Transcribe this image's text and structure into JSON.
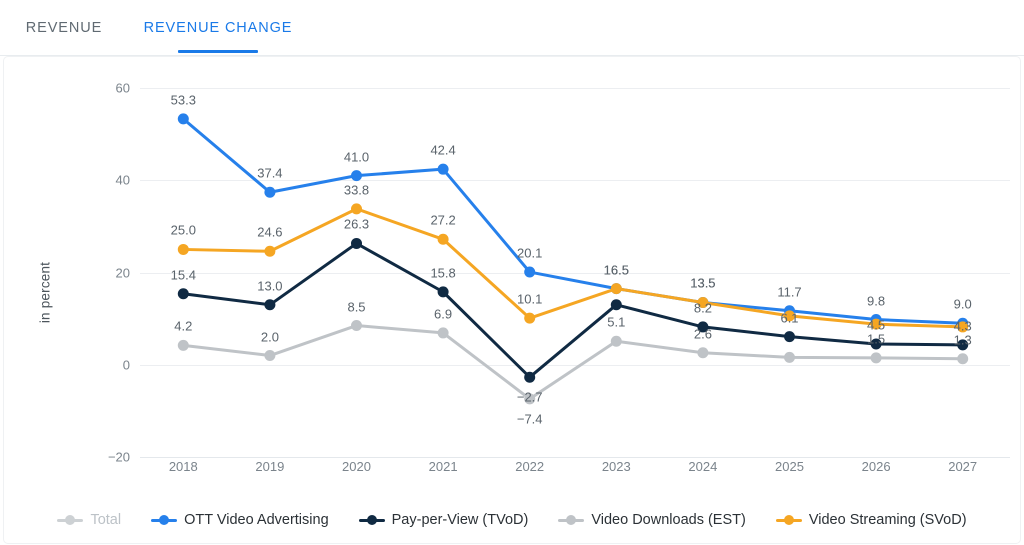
{
  "tabs": [
    {
      "label": "REVENUE",
      "active": false
    },
    {
      "label": "REVENUE CHANGE",
      "active": true
    }
  ],
  "colors": {
    "accent_blue": "#1a7ae8",
    "series_ott": "#2680eb",
    "series_tvod": "#102a43",
    "series_est": "#bfc3c7",
    "series_svod": "#f5a623",
    "series_total": "#cdd1d4",
    "tab_inactive": "#606a72",
    "gridline": "#eceef1",
    "label_text": "#5a636b"
  },
  "chart_data": {
    "type": "line",
    "title": "",
    "subtitle": "",
    "xlabel": "",
    "ylabel": "in percent",
    "categories": [
      "2018",
      "2019",
      "2020",
      "2021",
      "2022",
      "2023",
      "2024",
      "2025",
      "2026",
      "2027"
    ],
    "ylim": [
      -20,
      60
    ],
    "yticks": [
      60,
      40,
      20,
      0,
      -20
    ],
    "ytick_labels": [
      "60",
      "40",
      "20",
      "0",
      "−20"
    ],
    "grid": true,
    "legend_position": "bottom",
    "series": [
      {
        "name": "Total",
        "color": "#cdd1d4",
        "visible": false,
        "values": [
          null,
          null,
          null,
          null,
          null,
          null,
          null,
          null,
          null,
          null
        ],
        "labels": [
          "",
          "",
          "",
          "",
          "",
          "",
          "",
          "",
          "",
          ""
        ]
      },
      {
        "name": "OTT Video Advertising",
        "color": "#2680eb",
        "visible": true,
        "values": [
          53.3,
          37.4,
          41.0,
          42.4,
          20.1,
          16.5,
          13.5,
          11.7,
          9.8,
          9.0
        ],
        "labels": [
          "53.3",
          "37.4",
          "41.0",
          "42.4",
          "20.1",
          "16.5",
          "13.5",
          "11.7",
          "9.8",
          "9.0"
        ]
      },
      {
        "name": "Pay-per-View (TVoD)",
        "color": "#102a43",
        "visible": true,
        "values": [
          15.4,
          13.0,
          26.3,
          15.8,
          -2.7,
          13.0,
          8.2,
          6.1,
          4.5,
          4.3
        ],
        "labels": [
          "15.4",
          "13.0",
          "26.3",
          "15.8",
          "−2.7",
          "",
          "8.2",
          "6.1",
          "4.5",
          "4.3"
        ]
      },
      {
        "name": "Video Downloads (EST)",
        "color": "#bfc3c7",
        "visible": true,
        "values": [
          4.2,
          2.0,
          8.5,
          6.9,
          -7.4,
          5.1,
          2.6,
          1.6,
          1.5,
          1.3
        ],
        "labels": [
          "4.2",
          "2.0",
          "8.5",
          "6.9",
          "−7.4",
          "5.1",
          "2.6",
          "",
          "1.5",
          "1.3"
        ]
      },
      {
        "name": "Video Streaming (SVoD)",
        "color": "#f5a623",
        "visible": true,
        "values": [
          25.0,
          24.6,
          33.8,
          27.2,
          10.1,
          16.5,
          13.5,
          10.6,
          8.8,
          8.2
        ],
        "labels": [
          "25.0",
          "24.6",
          "33.8",
          "27.2",
          "10.1",
          "16.5",
          "13.5",
          "",
          "",
          ""
        ]
      }
    ]
  },
  "legend": [
    {
      "label": "Total",
      "color": "#cdd1d4",
      "disabled": true
    },
    {
      "label": "OTT Video Advertising",
      "color": "#2680eb",
      "disabled": false
    },
    {
      "label": "Pay-per-View (TVoD)",
      "color": "#102a43",
      "disabled": false
    },
    {
      "label": "Video Downloads (EST)",
      "color": "#bfc3c7",
      "disabled": false
    },
    {
      "label": "Video Streaming (SVoD)",
      "color": "#f5a623",
      "disabled": false
    }
  ]
}
